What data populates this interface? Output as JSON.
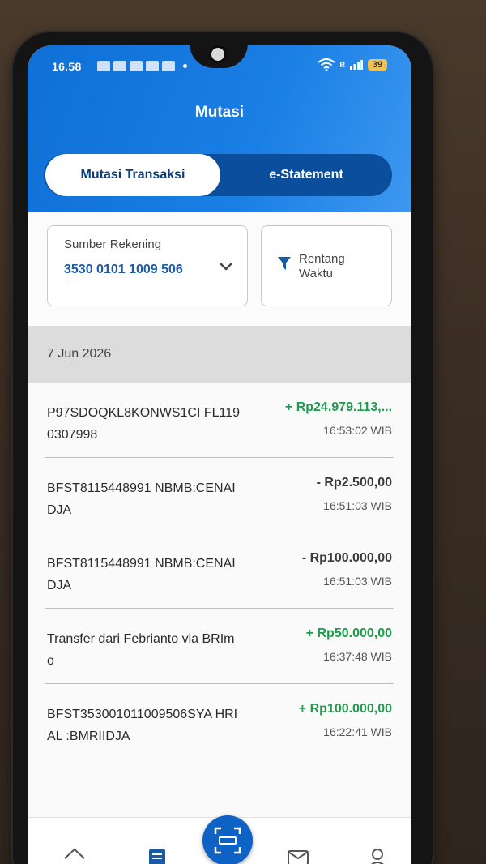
{
  "status_bar": {
    "time": "16.58",
    "signal_label": "R",
    "battery": "39"
  },
  "header": {
    "title": "Mutasi"
  },
  "tabs": {
    "active": "Mutasi Transaksi",
    "inactive": "e-Statement"
  },
  "account": {
    "label": "Sumber Rekening",
    "number": "3530 0101 1009 506"
  },
  "range": {
    "label": "Rentang Waktu"
  },
  "date_header": "7 Jun 2026",
  "transactions": [
    {
      "desc": "P97SDOQKL8KONWS1CI FL1190307998",
      "amount": "+ Rp24.979.113,...",
      "time": "16:53:02 WIB",
      "type": "credit"
    },
    {
      "desc": "BFST8115448991 NBMB:CENAIDJA",
      "amount": "- Rp2.500,00",
      "time": "16:51:03 WIB",
      "type": "debit"
    },
    {
      "desc": "BFST8115448991 NBMB:CENAIDJA",
      "amount": "- Rp100.000,00",
      "time": "16:51:03 WIB",
      "type": "debit"
    },
    {
      "desc": "Transfer dari Febrianto via BRImo",
      "amount": "+ Rp50.000,00",
      "time": "16:37:48 WIB",
      "type": "credit"
    },
    {
      "desc": "BFST353001011009506SYA HRIAL :BMRIIDJA",
      "amount": "+ Rp100.000,00",
      "time": "16:22:41 WIB",
      "type": "credit"
    }
  ],
  "bottom_nav": {
    "items": [
      "home-icon",
      "mutasi-icon",
      "qris-icon",
      "inbox-icon",
      "profile-icon"
    ]
  },
  "colors": {
    "primary": "#1a7fe4",
    "credit": "#1f9a4e",
    "debit": "#3a3a3a"
  }
}
